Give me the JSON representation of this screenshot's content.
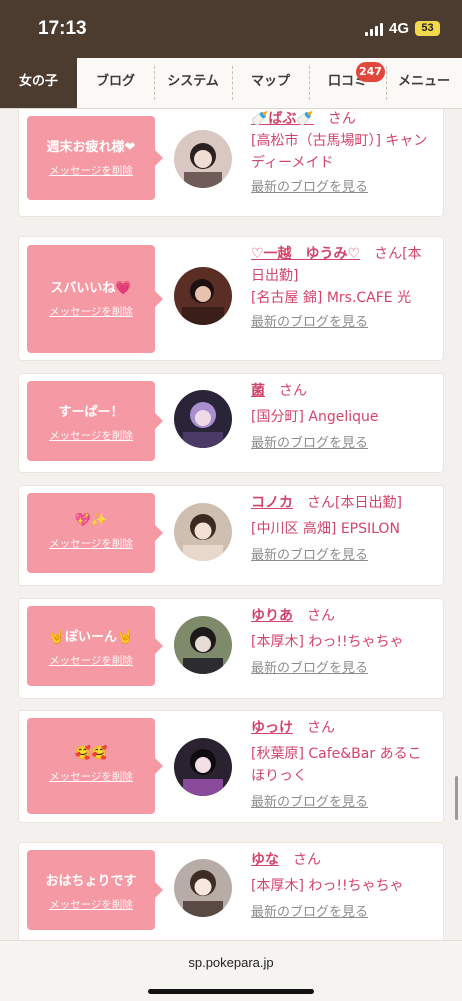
{
  "status_bar": {
    "time": "17:13",
    "network": "4G",
    "battery": "53"
  },
  "nav": {
    "tabs": [
      "女の子",
      "ブログ",
      "システム",
      "マップ",
      "口コミ",
      "メニュー"
    ],
    "active_tab": "女の子",
    "review_badge": "247"
  },
  "cards": [
    {
      "message": "週末お疲れ様❤",
      "delete_label": "メッセージを削除",
      "name": "🍼ばぶ🍼",
      "honorific": "さん",
      "shop_lines": [
        "[高松市（古馬場町）] キャン",
        "ディーメイド"
      ],
      "blog_label": "最新のブログを見る"
    },
    {
      "message": "スバいいね💗",
      "delete_label": "メッセージを削除",
      "name": "♡一越　ゆうみ♡",
      "honorific": "さん[本",
      "name_line2": "日出勤]",
      "shop_lines": [
        "[名古屋 錦] Mrs.CAFE 光"
      ],
      "blog_label": "最新のブログを見る"
    },
    {
      "message": "すーぱー！",
      "delete_label": "メッセージを削除",
      "name": "菌",
      "honorific": "さん",
      "shop_lines": [
        "[国分町] Angelique"
      ],
      "blog_label": "最新のブログを見る"
    },
    {
      "message": "💖✨",
      "delete_label": "メッセージを削除",
      "name": "コノカ",
      "honorific": "さん[本日出勤]",
      "shop_lines": [
        "[中川区 高畑] EPSILON"
      ],
      "blog_label": "最新のブログを見る"
    },
    {
      "message": "🤘ぽいーん🤘",
      "delete_label": "メッセージを削除",
      "name": "ゆりあ",
      "honorific": "さん",
      "shop_lines": [
        "[本厚木] わっ!!ちゃちゃ"
      ],
      "blog_label": "最新のブログを見る"
    },
    {
      "message": "🥰🥰",
      "delete_label": "メッセージを削除",
      "name": "ゆっけ",
      "honorific": "さん",
      "shop_lines": [
        "[秋葉原] Cafe&Bar あるこ",
        "ほりっく"
      ],
      "blog_label": "最新のブログを見る"
    },
    {
      "message": "おはちょりです",
      "delete_label": "メッセージを削除",
      "name": "ゆな",
      "honorific": "さん",
      "shop_lines": [
        "[本厚木] わっ!!ちゃちゃ"
      ],
      "blog_label": "最新のブログを見る"
    }
  ],
  "url_bar": {
    "domain": "sp.pokepara.jp"
  },
  "colors": {
    "brand_brown": "#4c3b2f",
    "bubble_pink": "#f59aa4",
    "name_pink": "#d2446a",
    "badge_red": "#e1473c"
  }
}
